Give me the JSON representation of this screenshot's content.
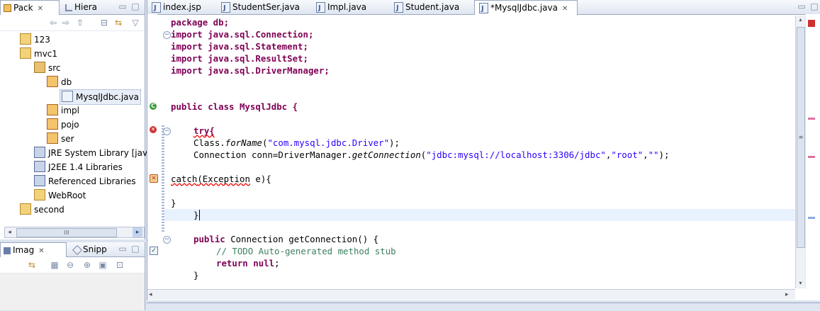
{
  "package_explorer": {
    "tabs": [
      {
        "label": "Pack",
        "close": "✕"
      },
      {
        "label": "Hiera"
      }
    ],
    "tree": [
      {
        "label": "123"
      },
      {
        "label": "mvc1"
      },
      {
        "label": "src"
      },
      {
        "label": "db"
      },
      {
        "label": "MysqlJdbc.java"
      },
      {
        "label": "impl"
      },
      {
        "label": "pojo"
      },
      {
        "label": "ser"
      },
      {
        "label": "JRE System Library [jav"
      },
      {
        "label": "J2EE 1.4 Libraries"
      },
      {
        "label": "Referenced Libraries"
      },
      {
        "label": "WebRoot"
      },
      {
        "label": "second"
      }
    ],
    "scrollbar_label": "III"
  },
  "image_panel": {
    "tabs": [
      {
        "label": "Imag",
        "close": "✕"
      },
      {
        "label": "Snipp"
      }
    ]
  },
  "editor": {
    "tabs": [
      {
        "label": "index.jsp"
      },
      {
        "label": "StudentSer.java"
      },
      {
        "label": "Impl.java"
      },
      {
        "label": "Student.java"
      },
      {
        "label": "*MysqlJdbc.java",
        "close": "✕"
      }
    ],
    "code": {
      "l1": "package db;",
      "l2": "import java.sql.Connection;",
      "l3": "import java.sql.Statement;",
      "l4": "import java.sql.ResultSet;",
      "l5": "import java.sql.DriverManager;",
      "l8": "public class MysqlJdbc {",
      "l10": "try{",
      "l11_a": "Class.",
      "l11_b": "forName",
      "l11_c": "(",
      "l11_d": "\"com.mysql.jdbc.Driver\"",
      "l11_e": ");",
      "l12_a": "Connection conn=DriverManager.",
      "l12_b": "getConnection",
      "l12_c": "(",
      "l12_d": "\"jdbc:mysql://localhost:3306/jdbc\"",
      "l12_e": ",",
      "l12_f": "\"root\"",
      "l12_g": ",",
      "l12_h": "\"\"",
      "l12_i": ");",
      "l14_a": "catch",
      "l14_b": "(Exception",
      "l14_c": " e){",
      "l16": "}",
      "l17": "}",
      "l19_a": "public",
      "l19_b": " Connection getConnection() {",
      "l20": "// TODO Auto-generated method stub",
      "l21_a": "return",
      "l21_b": " ",
      "l21_c": "null",
      "l21_d": ";",
      "l22": "}"
    }
  },
  "colors": {
    "keyword": "#7f0055",
    "string": "#2a00ff",
    "comment": "#3f7f5f",
    "selection_line": "#e8f2fe"
  }
}
